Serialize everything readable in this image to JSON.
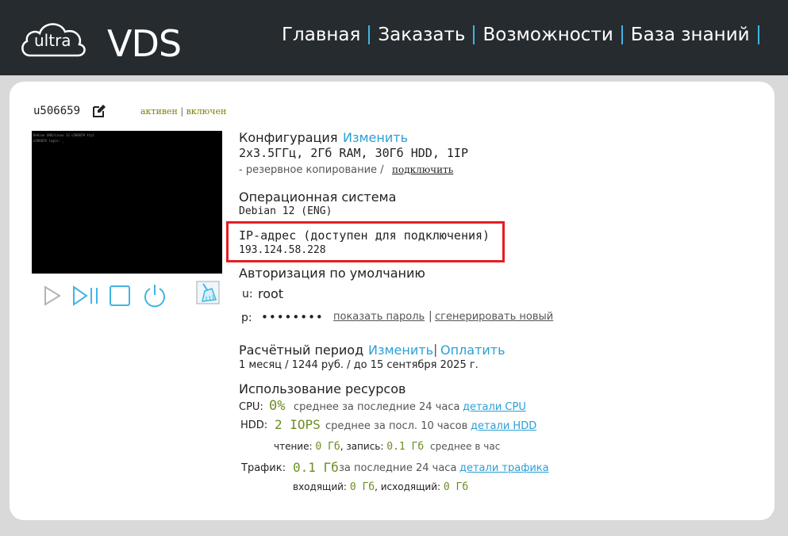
{
  "brand": {
    "ultra": "ultra",
    "vds": "VDS"
  },
  "nav": [
    {
      "label": "Главная"
    },
    {
      "label": "Заказать"
    },
    {
      "label": "Возможности"
    },
    {
      "label": "База знаний"
    }
  ],
  "server": {
    "id": "u506659",
    "status_active": "активен",
    "status_sep": "|",
    "status_on": "включен",
    "console_lines": [
      "Debian GNU/Linux 12 u506659 ttyl",
      "u506659 login: _"
    ]
  },
  "config": {
    "title": "Конфигурация",
    "change": "Изменить",
    "value": "2x3.5ГГц, 2Гб RAM, 30Гб HDD, 1IP",
    "backup_text": "- резервное копирование /",
    "backup_link": "подключить"
  },
  "os": {
    "title": "Операционная система",
    "value": "Debian 12 (ENG)"
  },
  "ip": {
    "title": "IP-адрес (доступен для подключения)",
    "value": "193.124.58.228"
  },
  "auth": {
    "title": "Авторизация по умолчанию",
    "user_label": "u:",
    "user": "root",
    "pass_label": "p:",
    "pass_mask": "••••••••",
    "show_password": "показать пароль",
    "sep": "|",
    "generate": "сгенерировать новый"
  },
  "billing": {
    "title": "Расчётный период",
    "change": "Изменить",
    "sep": "|",
    "pay": "Оплатить",
    "value": "1 месяц / 1244 руб. / до 15 сентября 2025 г."
  },
  "resources": {
    "title": "Использование ресурсов",
    "cpu_label": "CPU:",
    "cpu_value": "0%",
    "cpu_desc": "среднее за последние 24 часа",
    "cpu_link": "детали CPU",
    "hdd_label": "HDD:",
    "hdd_value": "2 IOPS",
    "hdd_desc": "среднее за посл. 10 часов",
    "hdd_link": "детали HDD",
    "read_label": "чтение:",
    "read_value": "0 Гб",
    "write_label": ", запись:",
    "write_value": "0.1 Гб",
    "rw_desc": "среднее в час",
    "traffic_label": "Трафик:",
    "traffic_value": "0.1 Гб",
    "traffic_desc": "за последние 24 часа",
    "traffic_link": "детали трафика",
    "in_label": "входящий:",
    "in_value": "0 Гб",
    "out_label": ", исходящий:",
    "out_value": "0 Гб"
  }
}
